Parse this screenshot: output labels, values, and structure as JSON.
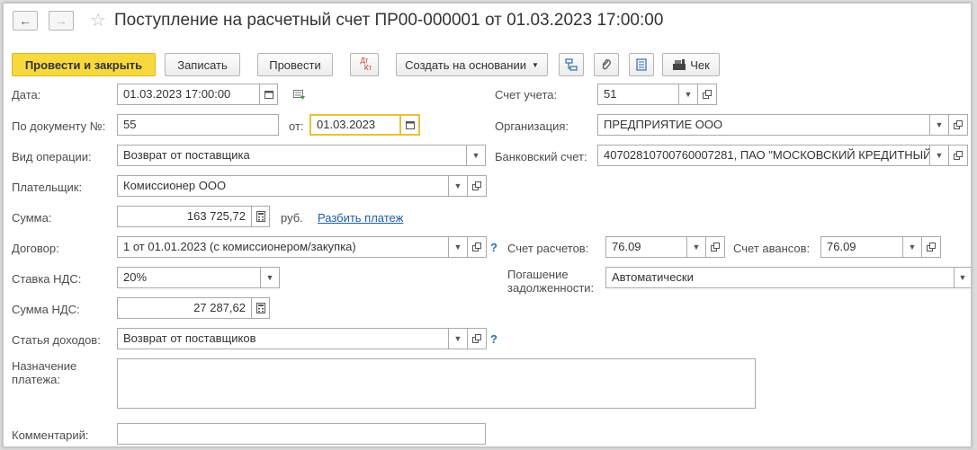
{
  "header": {
    "title": "Поступление на расчетный счет ПР00-000001 от 01.03.2023 17:00:00"
  },
  "toolbar": {
    "post_close": "Провести и закрыть",
    "save": "Записать",
    "post": "Провести",
    "dt_kt_top": "Дт",
    "dt_kt_bottom": "Кт",
    "create_based": "Создать на основании",
    "check": "Чек"
  },
  "form": {
    "date_label": "Дата:",
    "date_value": "01.03.2023 17:00:00",
    "doc_num_label": "По документу №:",
    "doc_num_value": "55",
    "from_label": "от:",
    "from_value": "01.03.2023",
    "op_type_label": "Вид операции:",
    "op_type_value": "Возврат от поставщика",
    "payer_label": "Плательщик:",
    "payer_value": "Комиссионер ООО",
    "sum_label": "Сумма:",
    "sum_value": "163 725,72",
    "currency": "руб.",
    "split_link": "Разбить платеж",
    "contract_label": "Договор:",
    "contract_value": "1 от 01.01.2023 (с комиссионером/закупка)",
    "vat_rate_label": "Ставка НДС:",
    "vat_rate_value": "20%",
    "vat_sum_label": "Сумма НДС:",
    "vat_sum_value": "27 287,62",
    "income_label": "Статья доходов:",
    "income_value": "Возврат от поставщиков",
    "purpose_label_1": "Назначение",
    "purpose_label_2": "платежа:",
    "purpose_value": "",
    "comment_label": "Комментарий:",
    "comment_value": "",
    "account_label": "Счет учета:",
    "account_value": "51",
    "org_label": "Организация:",
    "org_value": "ПРЕДПРИЯТИЕ ООО",
    "bank_label": "Банковский счет:",
    "bank_value": "40702810700760007281, ПАО \"МОСКОВСКИЙ КРЕДИТНЫЙ",
    "settle_label": "Счет расчетов:",
    "settle_value": "76.09",
    "advance_label": "Счет авансов:",
    "advance_value": "76.09",
    "repay_label_1": "Погашение",
    "repay_label_2": "задолженности:",
    "repay_value": "Автоматически",
    "help_mark": "?"
  },
  "colors": {
    "primary_button": "#f7d93f",
    "focus_border": "#e9c23b",
    "link": "#1d5ea8"
  }
}
